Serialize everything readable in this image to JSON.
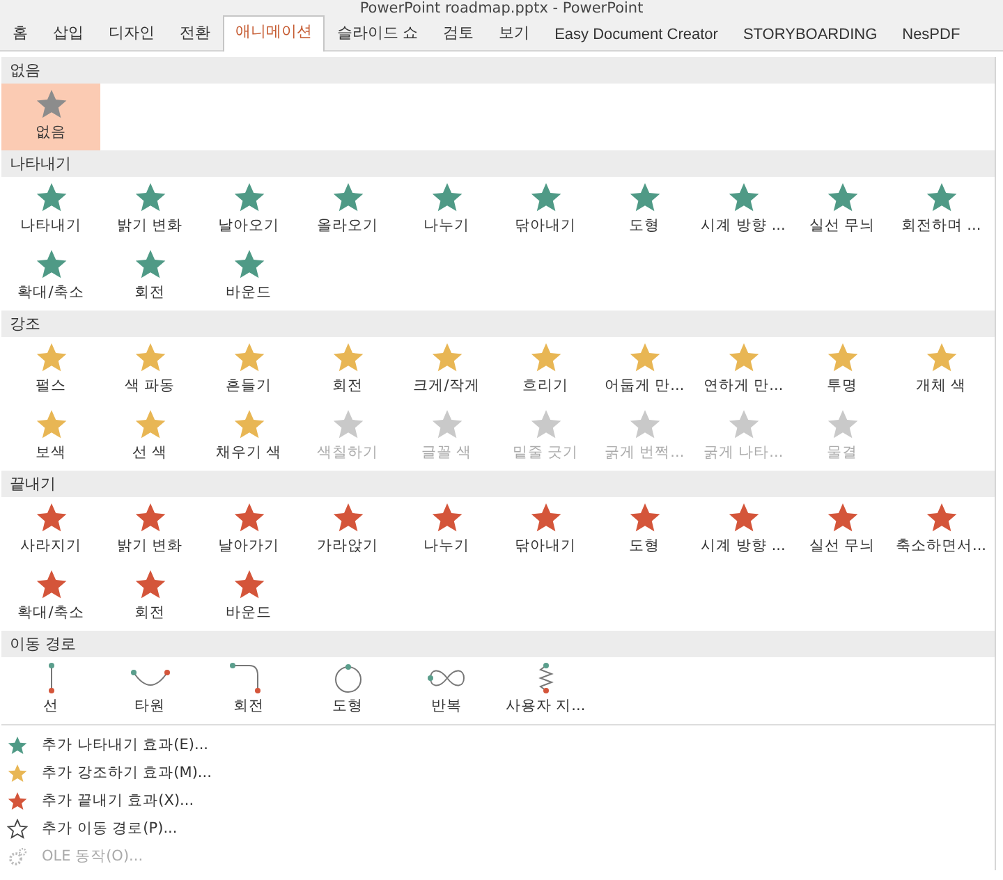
{
  "window": {
    "title": "PowerPoint roadmap.pptx - PowerPoint"
  },
  "tabs": [
    {
      "label": "홈",
      "selected": false
    },
    {
      "label": "삽입",
      "selected": false
    },
    {
      "label": "디자인",
      "selected": false
    },
    {
      "label": "전환",
      "selected": false
    },
    {
      "label": "애니메이션",
      "selected": true
    },
    {
      "label": "슬라이드 쇼",
      "selected": false
    },
    {
      "label": "검토",
      "selected": false
    },
    {
      "label": "보기",
      "selected": false
    },
    {
      "label": "Easy Document Creator",
      "selected": false
    },
    {
      "label": "STORYBOARDING",
      "selected": false
    },
    {
      "label": "NesPDF",
      "selected": false
    }
  ],
  "sections": [
    {
      "title": "없음",
      "kind": "none",
      "items": [
        {
          "label": "없음",
          "selected": true,
          "disabled": false
        }
      ]
    },
    {
      "title": "나타내기",
      "kind": "entrance",
      "items": [
        {
          "label": "나타내기",
          "selected": false,
          "disabled": false
        },
        {
          "label": "밝기 변화",
          "selected": false,
          "disabled": false
        },
        {
          "label": "날아오기",
          "selected": false,
          "disabled": false
        },
        {
          "label": "올라오기",
          "selected": false,
          "disabled": false
        },
        {
          "label": "나누기",
          "selected": false,
          "disabled": false
        },
        {
          "label": "닦아내기",
          "selected": false,
          "disabled": false
        },
        {
          "label": "도형",
          "selected": false,
          "disabled": false
        },
        {
          "label": "시계 방향 ...",
          "selected": false,
          "disabled": false
        },
        {
          "label": "실선 무늬",
          "selected": false,
          "disabled": false
        },
        {
          "label": "회전하며 ...",
          "selected": false,
          "disabled": false
        },
        {
          "label": "확대/축소",
          "selected": false,
          "disabled": false
        },
        {
          "label": "회전",
          "selected": false,
          "disabled": false
        },
        {
          "label": "바운드",
          "selected": false,
          "disabled": false
        }
      ]
    },
    {
      "title": "강조",
      "kind": "emphasis",
      "items": [
        {
          "label": "펄스",
          "selected": false,
          "disabled": false
        },
        {
          "label": "색 파동",
          "selected": false,
          "disabled": false
        },
        {
          "label": "흔들기",
          "selected": false,
          "disabled": false
        },
        {
          "label": "회전",
          "selected": false,
          "disabled": false
        },
        {
          "label": "크게/작게",
          "selected": false,
          "disabled": false
        },
        {
          "label": "흐리기",
          "selected": false,
          "disabled": false
        },
        {
          "label": "어둡게 만...",
          "selected": false,
          "disabled": false
        },
        {
          "label": "연하게 만...",
          "selected": false,
          "disabled": false
        },
        {
          "label": "투명",
          "selected": false,
          "disabled": false
        },
        {
          "label": "개체 색",
          "selected": false,
          "disabled": false
        },
        {
          "label": "보색",
          "selected": false,
          "disabled": false
        },
        {
          "label": "선 색",
          "selected": false,
          "disabled": false
        },
        {
          "label": "채우기 색",
          "selected": false,
          "disabled": false
        },
        {
          "label": "색칠하기",
          "selected": false,
          "disabled": true
        },
        {
          "label": "글꼴 색",
          "selected": false,
          "disabled": true
        },
        {
          "label": "밑줄 긋기",
          "selected": false,
          "disabled": true
        },
        {
          "label": "굵게 번쩍...",
          "selected": false,
          "disabled": true
        },
        {
          "label": "굵게 나타...",
          "selected": false,
          "disabled": true
        },
        {
          "label": "물결",
          "selected": false,
          "disabled": true
        }
      ]
    },
    {
      "title": "끝내기",
      "kind": "exit",
      "items": [
        {
          "label": "사라지기",
          "selected": false,
          "disabled": false
        },
        {
          "label": "밝기 변화",
          "selected": false,
          "disabled": false
        },
        {
          "label": "날아가기",
          "selected": false,
          "disabled": false
        },
        {
          "label": "가라앉기",
          "selected": false,
          "disabled": false
        },
        {
          "label": "나누기",
          "selected": false,
          "disabled": false
        },
        {
          "label": "닦아내기",
          "selected": false,
          "disabled": false
        },
        {
          "label": "도형",
          "selected": false,
          "disabled": false
        },
        {
          "label": "시계 방향 ...",
          "selected": false,
          "disabled": false
        },
        {
          "label": "실선 무늬",
          "selected": false,
          "disabled": false
        },
        {
          "label": "축소하면서...",
          "selected": false,
          "disabled": false
        },
        {
          "label": "확대/축소",
          "selected": false,
          "disabled": false
        },
        {
          "label": "회전",
          "selected": false,
          "disabled": false
        },
        {
          "label": "바운드",
          "selected": false,
          "disabled": false
        }
      ]
    },
    {
      "title": "이동 경로",
      "kind": "path",
      "items": [
        {
          "label": "선",
          "kind": "line",
          "selected": false,
          "disabled": false
        },
        {
          "label": "타원",
          "kind": "arc",
          "selected": false,
          "disabled": false
        },
        {
          "label": "회전",
          "kind": "turn",
          "selected": false,
          "disabled": false
        },
        {
          "label": "도형",
          "kind": "circle",
          "selected": false,
          "disabled": false
        },
        {
          "label": "반복",
          "kind": "loop",
          "selected": false,
          "disabled": false
        },
        {
          "label": "사용자 지...",
          "kind": "custom",
          "selected": false,
          "disabled": false
        }
      ]
    }
  ],
  "menu": [
    {
      "label": "추가 나타내기 효과(E)...",
      "kind": "entrance",
      "disabled": false
    },
    {
      "label": "추가 강조하기 효과(M)...",
      "kind": "emphasis",
      "disabled": false
    },
    {
      "label": "추가 끝내기 효과(X)...",
      "kind": "exit",
      "disabled": false
    },
    {
      "label": "추가 이동 경로(P)...",
      "kind": "path",
      "disabled": false
    },
    {
      "label": "OLE 동작(O)...",
      "kind": "ole",
      "disabled": true
    }
  ]
}
